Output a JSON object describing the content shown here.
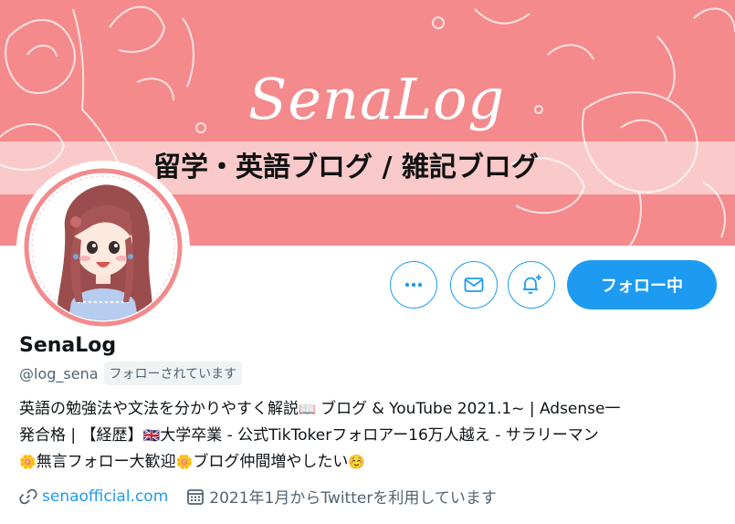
{
  "banner": {
    "logo": "SenaLog",
    "tagline": "留学・英語ブログ / 雑記ブログ",
    "background_color": "#f48a8c"
  },
  "avatar": {
    "ring_color": "#f28b8e",
    "icon": "avatar"
  },
  "actions": {
    "more_icon": "more-icon",
    "message_icon": "mail-icon",
    "notify_icon": "bell-plus-icon",
    "follow_label": "フォロー中",
    "accent_color": "#1d9bf0"
  },
  "profile": {
    "display_name": "SenaLog",
    "handle": "@log_sena",
    "follows_you": "フォローされています",
    "bio_line1": "英語の勉強法や文法を分かりやすく解説",
    "bio_line1_tail": " ブログ & YouTube 2021.1~ | Adsense一",
    "bio_line2": "発合格 | 【経歴】",
    "bio_line2_tail": "大学卒業 - 公式TikTokerフォロアー16万人越え - サラリーマン",
    "bio_line3a": "無言フォロー大歓迎",
    "bio_line3b": "ブログ仲間増やしたい",
    "emoji_book": "📖",
    "emoji_flag": "🇬🇧",
    "emoji_flower": "🌼",
    "emoji_smile": "☺️",
    "link": "senaofficial.com",
    "joined": "2021年1月からTwitterを利用しています"
  }
}
